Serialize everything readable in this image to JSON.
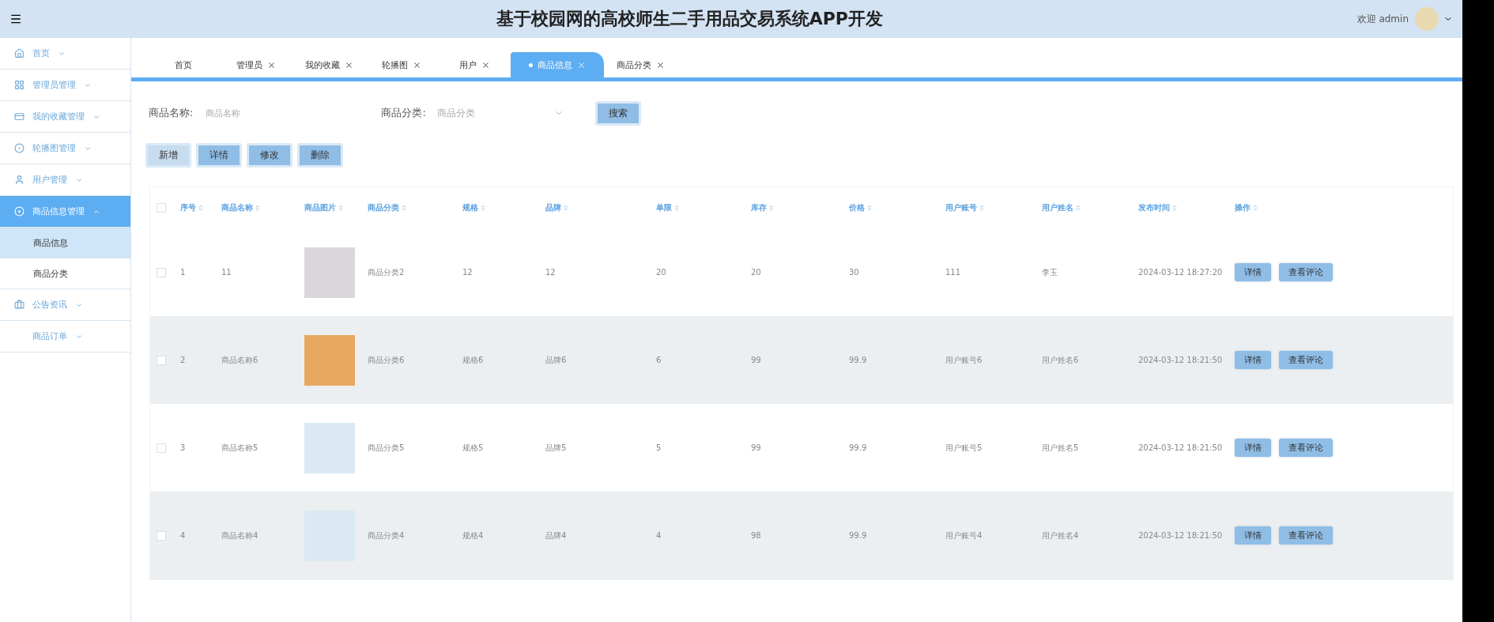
{
  "header": {
    "title": "基于校园网的高校师生二手用品交易系统APP开发",
    "welcome": "欢迎 admin"
  },
  "sidebar": {
    "items": [
      {
        "label": "首页",
        "selected": false,
        "expanded": false
      },
      {
        "label": "管理员管理",
        "selected": false,
        "expanded": false
      },
      {
        "label": "我的收藏管理",
        "selected": false,
        "expanded": false
      },
      {
        "label": "轮播图管理",
        "selected": false,
        "expanded": false
      },
      {
        "label": "用户管理",
        "selected": false,
        "expanded": false
      },
      {
        "label": "商品信息管理",
        "selected": true,
        "expanded": true,
        "children": [
          {
            "label": "商品信息",
            "selected": true
          },
          {
            "label": "商品分类",
            "selected": false
          }
        ]
      },
      {
        "label": "公告资讯",
        "selected": false,
        "expanded": false
      },
      {
        "label": "商品订单",
        "selected": false,
        "expanded": false
      }
    ]
  },
  "tabs": [
    {
      "label": "首页",
      "selected": false,
      "closable": false
    },
    {
      "label": "管理员",
      "selected": false,
      "closable": true
    },
    {
      "label": "我的收藏",
      "selected": false,
      "closable": true
    },
    {
      "label": "轮播图",
      "selected": false,
      "closable": true
    },
    {
      "label": "用户",
      "selected": false,
      "closable": true
    },
    {
      "label": "商品信息",
      "selected": true,
      "closable": true
    },
    {
      "label": "商品分类",
      "selected": false,
      "closable": true
    }
  ],
  "search": {
    "name_label": "商品名称:",
    "name_placeholder": "商品名称",
    "category_label": "商品分类:",
    "category_placeholder": "商品分类",
    "button": "搜索"
  },
  "actions": [
    "新增",
    "详情",
    "修改",
    "删除"
  ],
  "table": {
    "all_checked": false,
    "columns": [
      "序号",
      "商品名称",
      "商品图片",
      "商品分类",
      "规格",
      "品牌",
      "单限",
      "库存",
      "价格",
      "用户账号",
      "用户姓名",
      "发布时间",
      "操作"
    ],
    "rows": [
      {
        "cells": [
          "1",
          "11",
          "",
          "商品分类2",
          "12",
          "12",
          "20",
          "20",
          "30",
          "111",
          "李玉",
          "2024-03-12 18:27:20"
        ],
        "buttons": [
          "详情",
          "查看评论"
        ],
        "checked": false
      },
      {
        "cells": [
          "2",
          "商品名称6",
          "",
          "商品分类6",
          "规格6",
          "品牌6",
          "6",
          "99",
          "99.9",
          "用户账号6",
          "用户姓名6",
          "2024-03-12 18:21:50"
        ],
        "buttons": [
          "详情",
          "查看评论"
        ],
        "checked": false
      },
      {
        "cells": [
          "3",
          "商品名称5",
          "",
          "商品分类5",
          "规格5",
          "品牌5",
          "5",
          "99",
          "99.9",
          "用户账号5",
          "用户姓名5",
          "2024-03-12 18:21:50"
        ],
        "buttons": [
          "详情",
          "查看评论"
        ],
        "checked": false
      },
      {
        "cells": [
          "4",
          "商品名称4",
          "",
          "商品分类4",
          "规格4",
          "品牌4",
          "4",
          "98",
          "99.9",
          "用户账号4",
          "用户姓名4",
          "2024-03-12 18:21:50"
        ],
        "buttons": [
          "详情",
          "查看评论"
        ],
        "checked": false
      }
    ]
  }
}
